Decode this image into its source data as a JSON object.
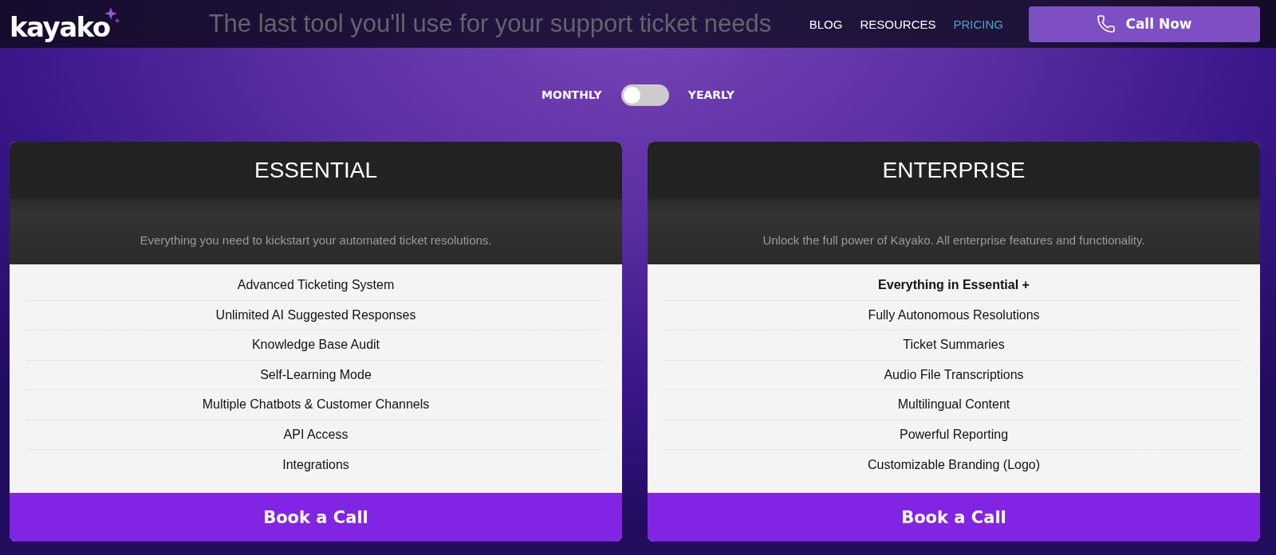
{
  "header": {
    "logo": "kayako",
    "headline": "The last tool you'll use for your support ticket needs",
    "nav": [
      {
        "label": "BLOG",
        "selected": false
      },
      {
        "label": "RESOURCES",
        "selected": false
      },
      {
        "label": "PRICING",
        "selected": true
      }
    ],
    "call_button": "Call Now"
  },
  "billing_toggle": {
    "left_label": "MONTHLY",
    "right_label": "YEARLY",
    "on": false
  },
  "plans": [
    {
      "name": "ESSENTIAL",
      "description": "Everything you need to kickstart your automated ticket resolutions.",
      "features": [
        {
          "kind": "plain",
          "text": "Advanced Ticketing System"
        },
        {
          "kind": "plain",
          "text": "Unlimited AI Suggested Responses"
        },
        {
          "kind": "plain",
          "text": "Knowledge Base Audit"
        },
        {
          "kind": "plain",
          "text": "Self-Learning Mode"
        },
        {
          "kind": "plain",
          "text": "Multiple Chatbots & Customer Channels"
        },
        {
          "kind": "plain",
          "text": "API Access"
        },
        {
          "kind": "plain",
          "text": "Integrations"
        }
      ],
      "button": "Book a Call"
    },
    {
      "name": "ENTERPRISE",
      "description": "Unlock the full power of Kayako. All enterprise features and functionality.",
      "features": [
        {
          "kind": "heading",
          "text": "Everything in Essential +"
        },
        {
          "kind": "plain",
          "text": "Fully Autonomous Resolutions"
        },
        {
          "kind": "plain",
          "text": "Ticket Summaries"
        },
        {
          "kind": "plain",
          "text": "Audio File Transcriptions"
        },
        {
          "kind": "plain",
          "text": "Multilingual Content"
        },
        {
          "kind": "plain",
          "text": "Powerful Reporting"
        },
        {
          "kind": "plain",
          "text": "Customizable Branding (Logo)"
        }
      ],
      "button": "Book a Call"
    }
  ]
}
